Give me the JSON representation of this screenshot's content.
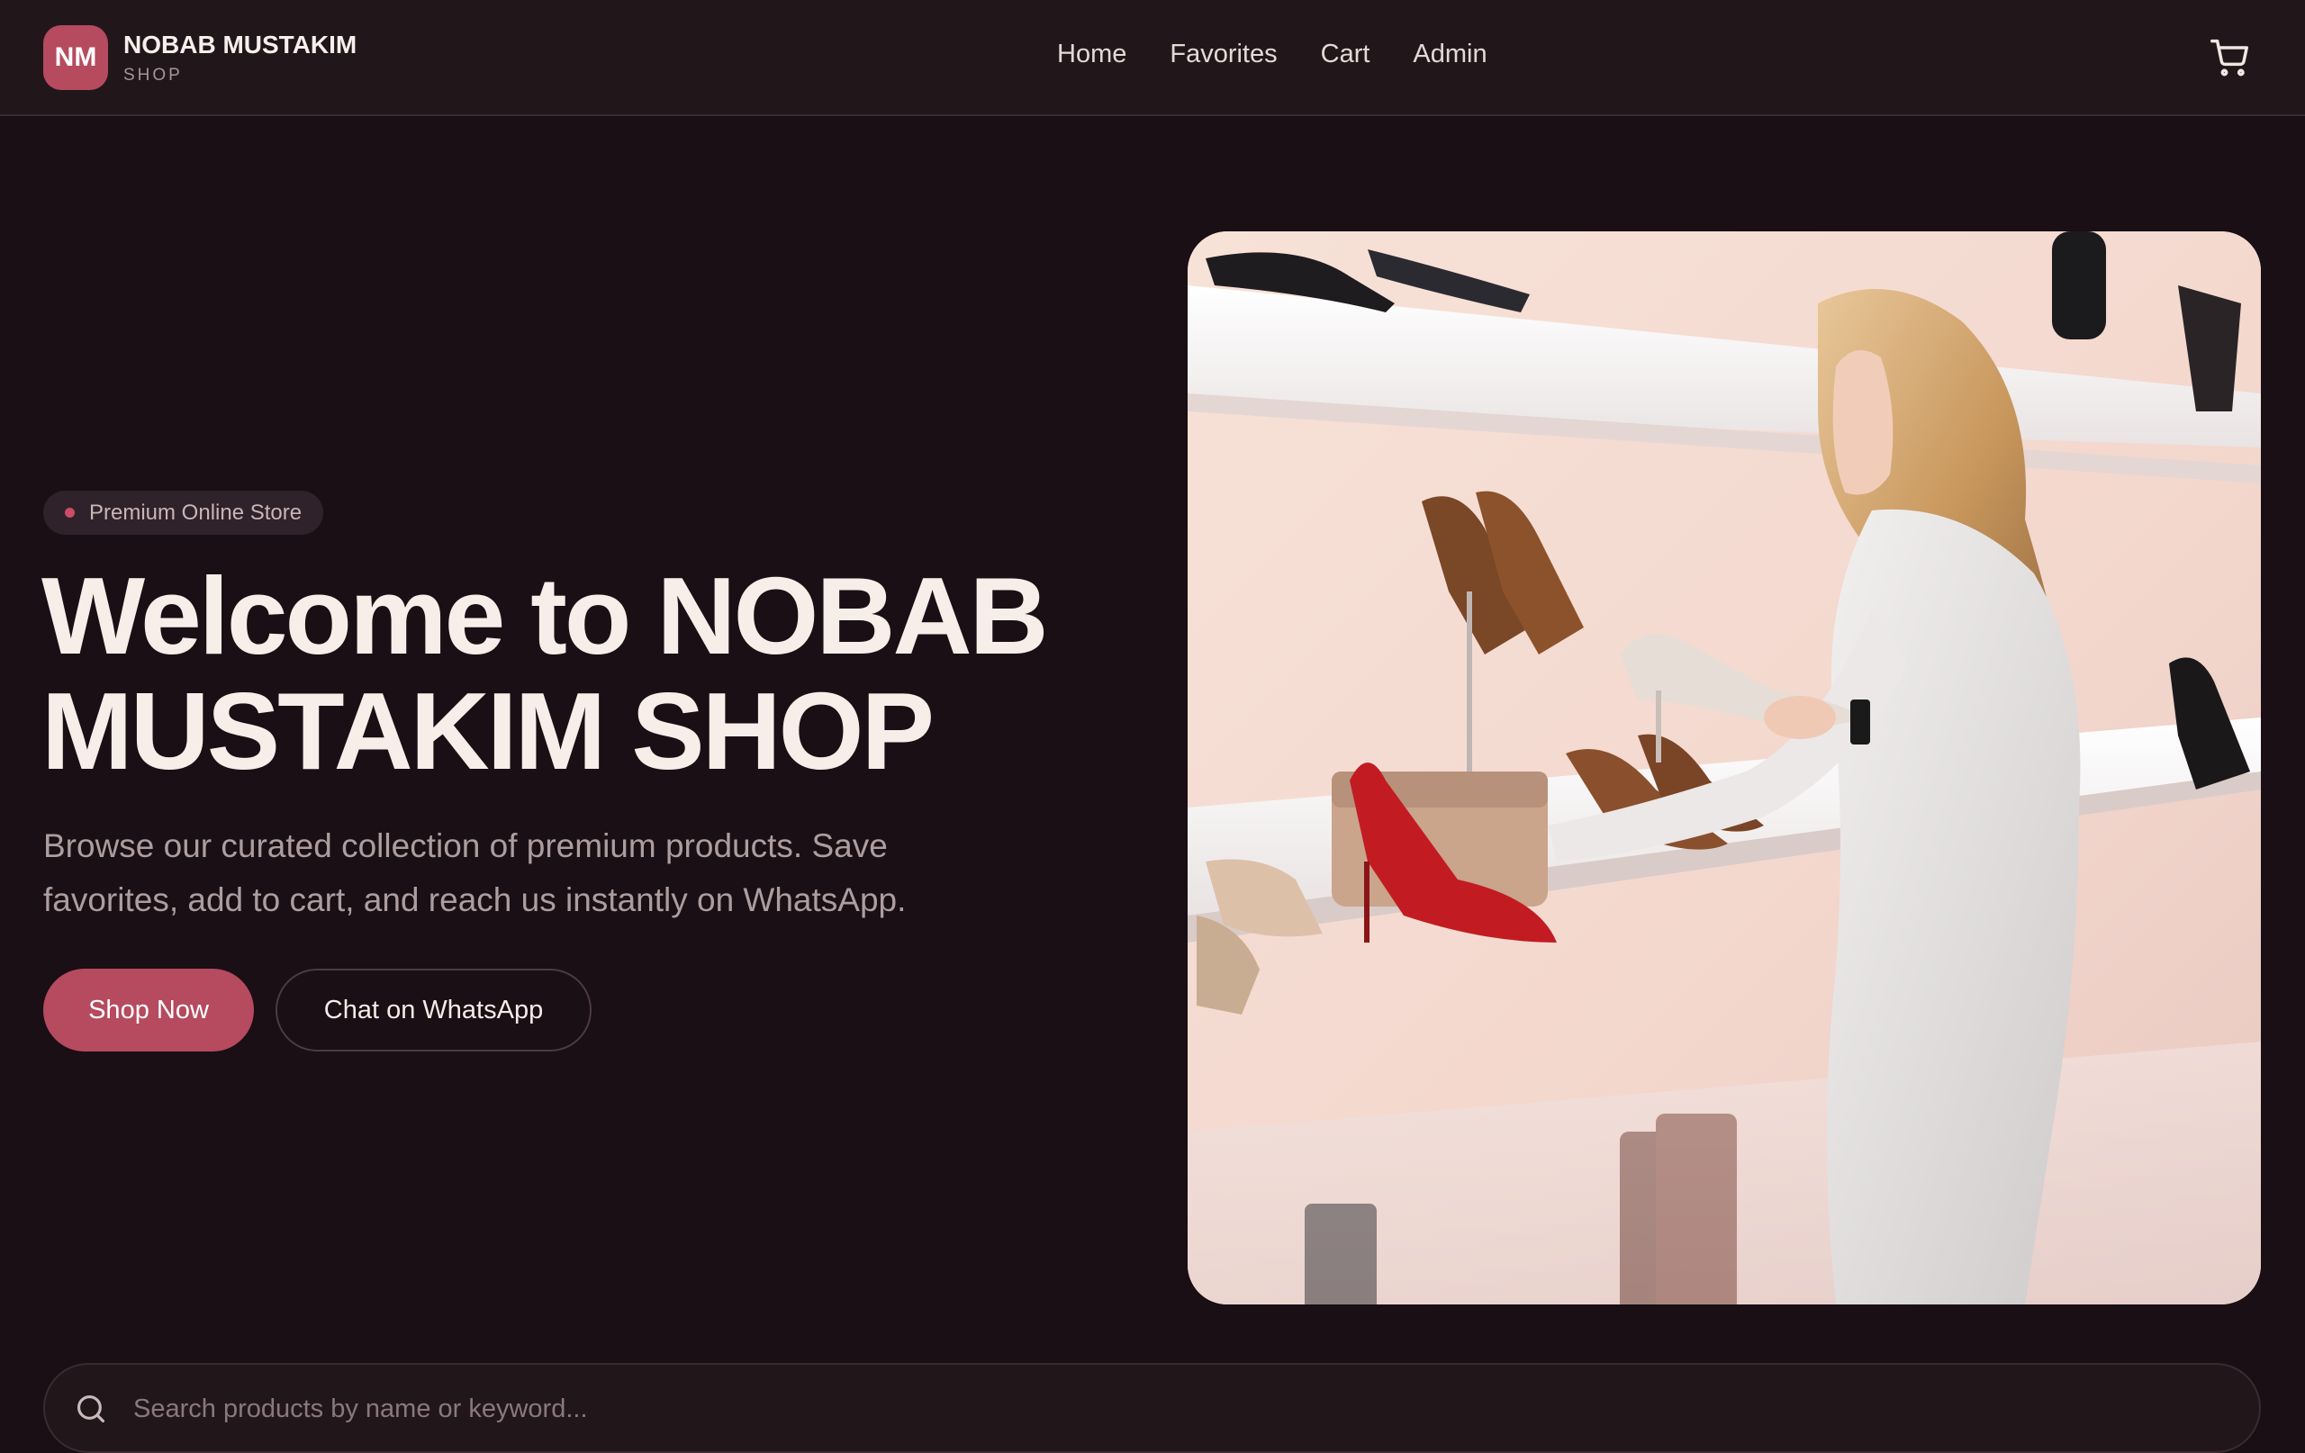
{
  "brand": {
    "initials": "NM",
    "name": "NOBAB MUSTAKIM",
    "subtitle": "SHOP"
  },
  "nav": {
    "items": [
      {
        "label": "Home"
      },
      {
        "label": "Favorites"
      },
      {
        "label": "Cart"
      },
      {
        "label": "Admin"
      }
    ],
    "cart_icon": "shopping-cart-icon"
  },
  "hero": {
    "badge": "Premium Online Store",
    "title": "Welcome to NOBAB MUSTAKIM SHOP",
    "description": "Browse our curated collection of premium products. Save favorites, add to cart, and reach us instantly on WhatsApp.",
    "primary_button": "Shop Now",
    "secondary_button": "Chat on WhatsApp"
  },
  "search": {
    "placeholder": "Search products by name or keyword...",
    "value": "",
    "icon": "search-icon"
  },
  "colors": {
    "accent": "#b64a5f",
    "background": "#190f14",
    "header": "#21171b"
  }
}
